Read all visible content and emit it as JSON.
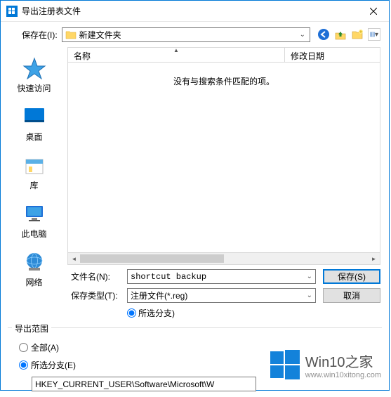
{
  "titlebar": {
    "title": "导出注册表文件"
  },
  "toolbar": {
    "save_in_label": "保存在(I):",
    "path": "新建文件夹"
  },
  "sidebar": {
    "items": [
      {
        "label": "快速访问"
      },
      {
        "label": "桌面"
      },
      {
        "label": "库"
      },
      {
        "label": "此电脑"
      },
      {
        "label": "网络"
      }
    ]
  },
  "columns": {
    "name": "名称",
    "date": "修改日期"
  },
  "empty_message": "没有与搜索条件匹配的项。",
  "form": {
    "filename_label": "文件名(N):",
    "filename_value": "shortcut backup",
    "filetype_label": "保存类型(T):",
    "filetype_value": "注册文件(*.reg)",
    "selected_branch_inline": "所选分支)",
    "save_button": "保存(S)",
    "cancel_button": "取消"
  },
  "export": {
    "section_label": "导出范围",
    "all_label": "全部(A)",
    "selected_label": "所选分支(E)",
    "path_value": "HKEY_CURRENT_USER\\Software\\Microsoft\\W"
  },
  "watermark": {
    "title": "Win10之家",
    "url": "www.win10xitong.com"
  }
}
